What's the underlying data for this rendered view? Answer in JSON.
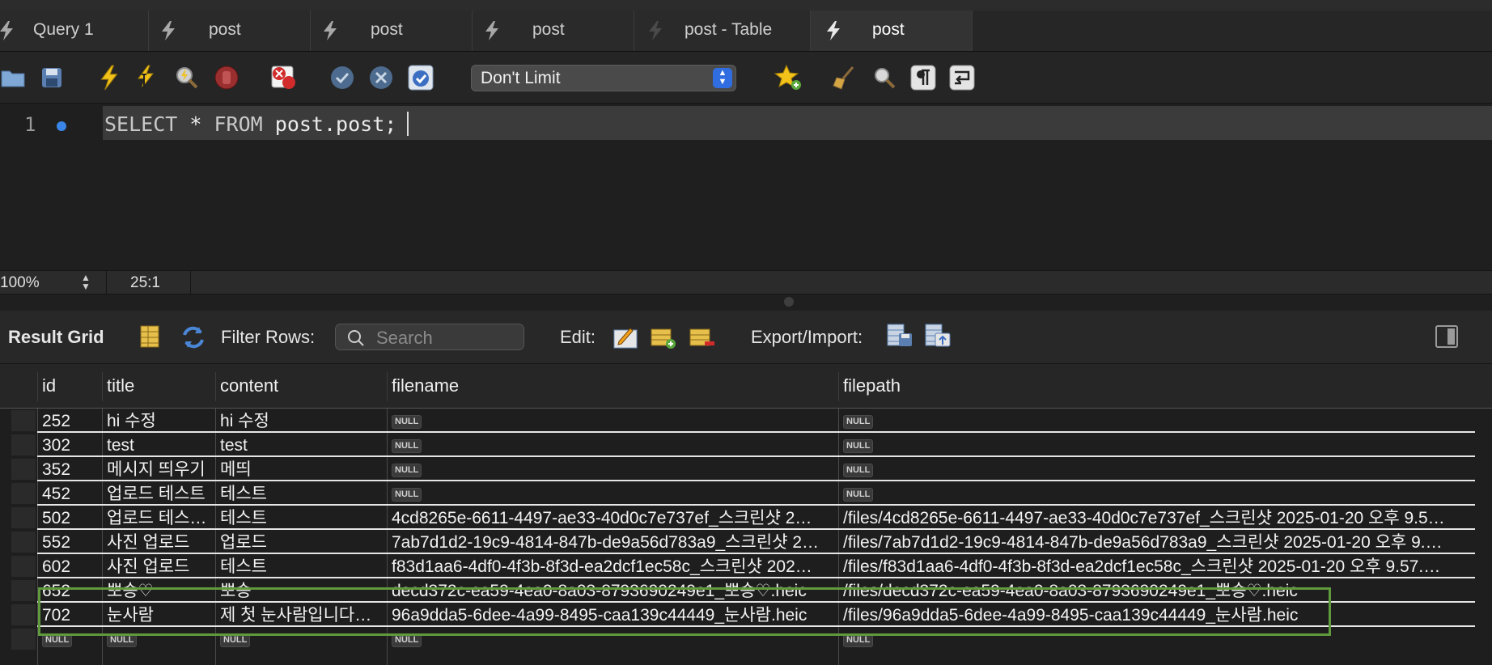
{
  "tabs": [
    {
      "label": "Query 1",
      "icon": "lightning-icon",
      "active": false
    },
    {
      "label": "post",
      "icon": "lightning-icon",
      "active": false
    },
    {
      "label": "post",
      "icon": "lightning-icon",
      "active": false
    },
    {
      "label": "post",
      "icon": "lightning-icon",
      "active": false
    },
    {
      "label": "post - Table",
      "icon": "table-icon",
      "active": false
    },
    {
      "label": "post",
      "icon": "lightning-icon",
      "active": true
    }
  ],
  "toolbar": {
    "limit_select": "Don't Limit"
  },
  "editor": {
    "line_number": "1",
    "keyword_select": "SELECT",
    "star": "*",
    "keyword_from": "FROM",
    "table": "post.post;"
  },
  "status": {
    "zoom": "100%",
    "cursor_position": "25:1"
  },
  "results": {
    "result_grid_label": "Result Grid",
    "filter_label": "Filter Rows:",
    "search_placeholder": "Search",
    "edit_label": "Edit:",
    "export_label": "Export/Import:",
    "columns": [
      "id",
      "title",
      "content",
      "filename",
      "filepath"
    ],
    "null_label": "NULL",
    "rows": [
      [
        "252",
        "hi 수정",
        "hi 수정",
        null,
        null
      ],
      [
        "302",
        "test",
        "test",
        null,
        null
      ],
      [
        "352",
        "메시지 띄우기",
        "메띄",
        null,
        null
      ],
      [
        "452",
        "업로드 테스트",
        "테스트",
        null,
        null
      ],
      [
        "502",
        "업로드 테스…",
        "테스트",
        "4cd8265e-6611-4497-ae33-40d0c7e737ef_스크린샷 2…",
        "/files/4cd8265e-6611-4497-ae33-40d0c7e737ef_스크린샷 2025-01-20 오후 9.5…"
      ],
      [
        "552",
        "사진 업로드",
        "업로드",
        "7ab7d1d2-19c9-4814-847b-de9a56d783a9_스크린샷 2…",
        "/files/7ab7d1d2-19c9-4814-847b-de9a56d783a9_스크린샷 2025-01-20 오후 9.…"
      ],
      [
        "602",
        "사진 업로드",
        "테스트",
        "f83d1aa6-4df0-4f3b-8f3d-ea2dcf1ec58c_스크린샷 202…",
        "/files/f83d1aa6-4df0-4f3b-8f3d-ea2dcf1ec58c_스크린샷 2025-01-20 오후 9.57.…"
      ],
      [
        "652",
        "뽀송♡",
        "뽀송",
        "decd372c-ea59-4ea0-8a03-8793690249e1_뽀송♡.heic",
        "/files/decd372c-ea59-4ea0-8a03-8793690249e1_뽀송♡.heic"
      ],
      [
        "702",
        "눈사람",
        "제 첫 눈사람입니다람쥐",
        "96a9dda5-6dee-4a99-8495-caa139c44449_눈사람.heic",
        "/files/96a9dda5-6dee-4a99-8495-caa139c44449_눈사람.heic"
      ],
      [
        null,
        null,
        null,
        null,
        null
      ]
    ]
  },
  "colors": {
    "selection_outline": "#5f9a3c",
    "stepper_blue": "#2f6de0",
    "lightning_yellow": "#f2c21a"
  }
}
